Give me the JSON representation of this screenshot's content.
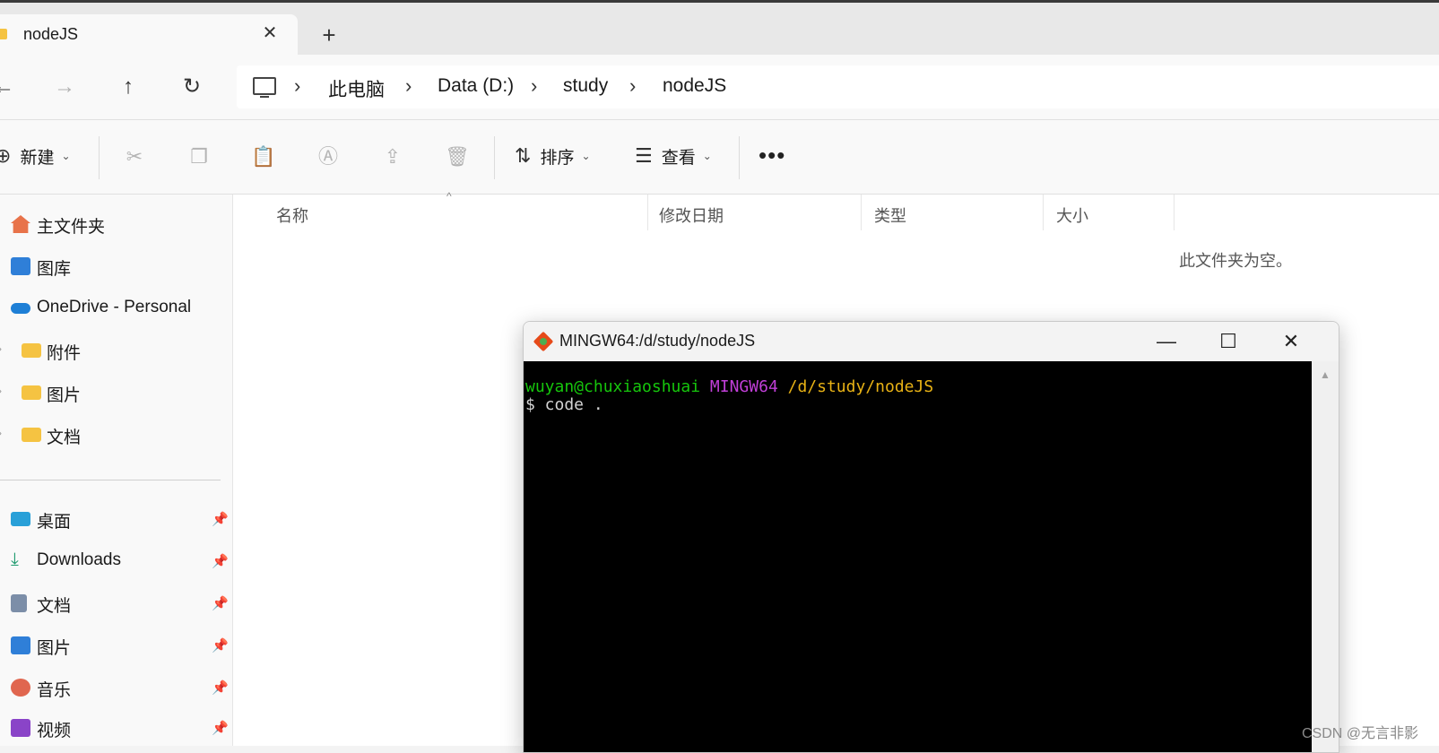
{
  "tab": {
    "title": "nodeJS",
    "close": "✕",
    "new_tab": "+"
  },
  "nav": {
    "back": "←",
    "forward": "→",
    "up": "↑",
    "refresh": "↻",
    "breadcrumbs": [
      "此电脑",
      "Data (D:)",
      "study",
      "nodeJS"
    ],
    "separator": "›"
  },
  "commands": {
    "new_label": "新建",
    "sort_label": "排序",
    "view_label": "查看",
    "more": "•••"
  },
  "sidebar": {
    "top": [
      {
        "label": "主文件夹"
      },
      {
        "label": "图库"
      },
      {
        "label": "OneDrive - Personal"
      },
      {
        "label": "附件"
      },
      {
        "label": "图片"
      },
      {
        "label": "文档"
      }
    ],
    "pinned": [
      {
        "label": "桌面"
      },
      {
        "label": "Downloads"
      },
      {
        "label": "文档"
      },
      {
        "label": "图片"
      },
      {
        "label": "音乐"
      },
      {
        "label": "视频"
      }
    ]
  },
  "columns": {
    "name": "名称",
    "modified": "修改日期",
    "type": "类型",
    "size": "大小"
  },
  "empty_message": "此文件夹为空。",
  "terminal": {
    "title": "MINGW64:/d/study/nodeJS",
    "minimize": "—",
    "maximize": "☐",
    "close": "✕",
    "user_host": "wuyan@chuxiaoshuai",
    "env": "MINGW64",
    "path": "/d/study/nodeJS",
    "command_line": "$ code .",
    "colors": {
      "user": "#16c60c",
      "env": "#c13fd8",
      "path": "#e8b215",
      "text": "#d4d4d4"
    }
  },
  "watermark": "CSDN @无言非影"
}
